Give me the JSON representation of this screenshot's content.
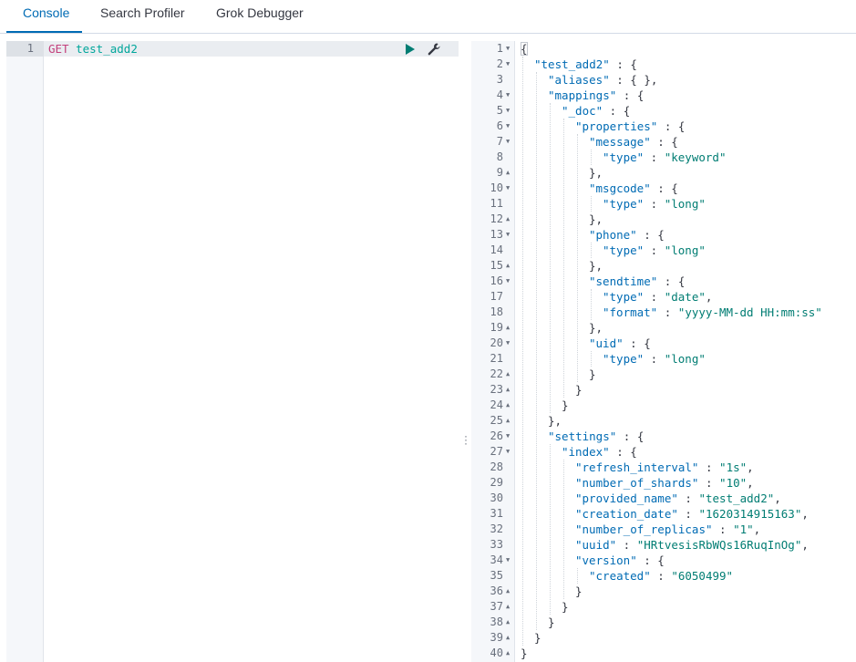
{
  "tabs": [
    {
      "label": "Console",
      "active": true
    },
    {
      "label": "Search Profiler",
      "active": false
    },
    {
      "label": "Grok Debugger",
      "active": false
    }
  ],
  "request": {
    "line_number": "1",
    "method": "GET",
    "path": "test_add2"
  },
  "icons": {
    "run": "play-icon",
    "settings": "wrench-icon",
    "resize": "vertical-dots-icon"
  },
  "colors": {
    "accent": "#006bb4",
    "method": "#c4407c",
    "path": "#00a69b",
    "string": "#017d73"
  },
  "response": {
    "lines": [
      {
        "n": "1",
        "fold": "open",
        "indent": 0,
        "parts": [
          [
            "p",
            "{"
          ]
        ]
      },
      {
        "n": "2",
        "fold": "open",
        "indent": 1,
        "parts": [
          [
            "k",
            "\"test_add2\""
          ],
          [
            "p",
            " : {"
          ]
        ]
      },
      {
        "n": "3",
        "fold": "",
        "indent": 2,
        "parts": [
          [
            "k",
            "\"aliases\""
          ],
          [
            "p",
            " : { },"
          ]
        ]
      },
      {
        "n": "4",
        "fold": "open",
        "indent": 2,
        "parts": [
          [
            "k",
            "\"mappings\""
          ],
          [
            "p",
            " : {"
          ]
        ]
      },
      {
        "n": "5",
        "fold": "open",
        "indent": 3,
        "parts": [
          [
            "k",
            "\"_doc\""
          ],
          [
            "p",
            " : {"
          ]
        ]
      },
      {
        "n": "6",
        "fold": "open",
        "indent": 4,
        "parts": [
          [
            "k",
            "\"properties\""
          ],
          [
            "p",
            " : {"
          ]
        ]
      },
      {
        "n": "7",
        "fold": "open",
        "indent": 5,
        "parts": [
          [
            "k",
            "\"message\""
          ],
          [
            "p",
            " : {"
          ]
        ]
      },
      {
        "n": "8",
        "fold": "",
        "indent": 6,
        "parts": [
          [
            "k",
            "\"type\""
          ],
          [
            "p",
            " : "
          ],
          [
            "s",
            "\"keyword\""
          ]
        ]
      },
      {
        "n": "9",
        "fold": "close",
        "indent": 5,
        "parts": [
          [
            "p",
            "},"
          ]
        ]
      },
      {
        "n": "10",
        "fold": "open",
        "indent": 5,
        "parts": [
          [
            "k",
            "\"msgcode\""
          ],
          [
            "p",
            " : {"
          ]
        ]
      },
      {
        "n": "11",
        "fold": "",
        "indent": 6,
        "parts": [
          [
            "k",
            "\"type\""
          ],
          [
            "p",
            " : "
          ],
          [
            "s",
            "\"long\""
          ]
        ]
      },
      {
        "n": "12",
        "fold": "close",
        "indent": 5,
        "parts": [
          [
            "p",
            "},"
          ]
        ]
      },
      {
        "n": "13",
        "fold": "open",
        "indent": 5,
        "parts": [
          [
            "k",
            "\"phone\""
          ],
          [
            "p",
            " : {"
          ]
        ]
      },
      {
        "n": "14",
        "fold": "",
        "indent": 6,
        "parts": [
          [
            "k",
            "\"type\""
          ],
          [
            "p",
            " : "
          ],
          [
            "s",
            "\"long\""
          ]
        ]
      },
      {
        "n": "15",
        "fold": "close",
        "indent": 5,
        "parts": [
          [
            "p",
            "},"
          ]
        ]
      },
      {
        "n": "16",
        "fold": "open",
        "indent": 5,
        "parts": [
          [
            "k",
            "\"sendtime\""
          ],
          [
            "p",
            " : {"
          ]
        ]
      },
      {
        "n": "17",
        "fold": "",
        "indent": 6,
        "parts": [
          [
            "k",
            "\"type\""
          ],
          [
            "p",
            " : "
          ],
          [
            "s",
            "\"date\""
          ],
          [
            "p",
            ","
          ]
        ]
      },
      {
        "n": "18",
        "fold": "",
        "indent": 6,
        "parts": [
          [
            "k",
            "\"format\""
          ],
          [
            "p",
            " : "
          ],
          [
            "s",
            "\"yyyy-MM-dd HH:mm:ss\""
          ]
        ]
      },
      {
        "n": "19",
        "fold": "close",
        "indent": 5,
        "parts": [
          [
            "p",
            "},"
          ]
        ]
      },
      {
        "n": "20",
        "fold": "open",
        "indent": 5,
        "parts": [
          [
            "k",
            "\"uid\""
          ],
          [
            "p",
            " : {"
          ]
        ]
      },
      {
        "n": "21",
        "fold": "",
        "indent": 6,
        "parts": [
          [
            "k",
            "\"type\""
          ],
          [
            "p",
            " : "
          ],
          [
            "s",
            "\"long\""
          ]
        ]
      },
      {
        "n": "22",
        "fold": "close",
        "indent": 5,
        "parts": [
          [
            "p",
            "}"
          ]
        ]
      },
      {
        "n": "23",
        "fold": "close",
        "indent": 4,
        "parts": [
          [
            "p",
            "}"
          ]
        ]
      },
      {
        "n": "24",
        "fold": "close",
        "indent": 3,
        "parts": [
          [
            "p",
            "}"
          ]
        ]
      },
      {
        "n": "25",
        "fold": "close",
        "indent": 2,
        "parts": [
          [
            "p",
            "},"
          ]
        ]
      },
      {
        "n": "26",
        "fold": "open",
        "indent": 2,
        "parts": [
          [
            "k",
            "\"settings\""
          ],
          [
            "p",
            " : {"
          ]
        ]
      },
      {
        "n": "27",
        "fold": "open",
        "indent": 3,
        "parts": [
          [
            "k",
            "\"index\""
          ],
          [
            "p",
            " : {"
          ]
        ]
      },
      {
        "n": "28",
        "fold": "",
        "indent": 4,
        "parts": [
          [
            "k",
            "\"refresh_interval\""
          ],
          [
            "p",
            " : "
          ],
          [
            "s",
            "\"1s\""
          ],
          [
            "p",
            ","
          ]
        ]
      },
      {
        "n": "29",
        "fold": "",
        "indent": 4,
        "parts": [
          [
            "k",
            "\"number_of_shards\""
          ],
          [
            "p",
            " : "
          ],
          [
            "s",
            "\"10\""
          ],
          [
            "p",
            ","
          ]
        ]
      },
      {
        "n": "30",
        "fold": "",
        "indent": 4,
        "parts": [
          [
            "k",
            "\"provided_name\""
          ],
          [
            "p",
            " : "
          ],
          [
            "s",
            "\"test_add2\""
          ],
          [
            "p",
            ","
          ]
        ]
      },
      {
        "n": "31",
        "fold": "",
        "indent": 4,
        "parts": [
          [
            "k",
            "\"creation_date\""
          ],
          [
            "p",
            " : "
          ],
          [
            "s",
            "\"1620314915163\""
          ],
          [
            "p",
            ","
          ]
        ]
      },
      {
        "n": "32",
        "fold": "",
        "indent": 4,
        "parts": [
          [
            "k",
            "\"number_of_replicas\""
          ],
          [
            "p",
            " : "
          ],
          [
            "s",
            "\"1\""
          ],
          [
            "p",
            ","
          ]
        ]
      },
      {
        "n": "33",
        "fold": "",
        "indent": 4,
        "parts": [
          [
            "k",
            "\"uuid\""
          ],
          [
            "p",
            " : "
          ],
          [
            "s",
            "\"HRtvesisRbWQs16RuqInOg\""
          ],
          [
            "p",
            ","
          ]
        ]
      },
      {
        "n": "34",
        "fold": "open",
        "indent": 4,
        "parts": [
          [
            "k",
            "\"version\""
          ],
          [
            "p",
            " : {"
          ]
        ]
      },
      {
        "n": "35",
        "fold": "",
        "indent": 5,
        "parts": [
          [
            "k",
            "\"created\""
          ],
          [
            "p",
            " : "
          ],
          [
            "s",
            "\"6050499\""
          ]
        ]
      },
      {
        "n": "36",
        "fold": "close",
        "indent": 4,
        "parts": [
          [
            "p",
            "}"
          ]
        ]
      },
      {
        "n": "37",
        "fold": "close",
        "indent": 3,
        "parts": [
          [
            "p",
            "}"
          ]
        ]
      },
      {
        "n": "38",
        "fold": "close",
        "indent": 2,
        "parts": [
          [
            "p",
            "}"
          ]
        ]
      },
      {
        "n": "39",
        "fold": "close",
        "indent": 1,
        "parts": [
          [
            "p",
            "}"
          ]
        ]
      },
      {
        "n": "40",
        "fold": "close",
        "indent": 0,
        "parts": [
          [
            "p",
            "}"
          ]
        ]
      }
    ]
  }
}
